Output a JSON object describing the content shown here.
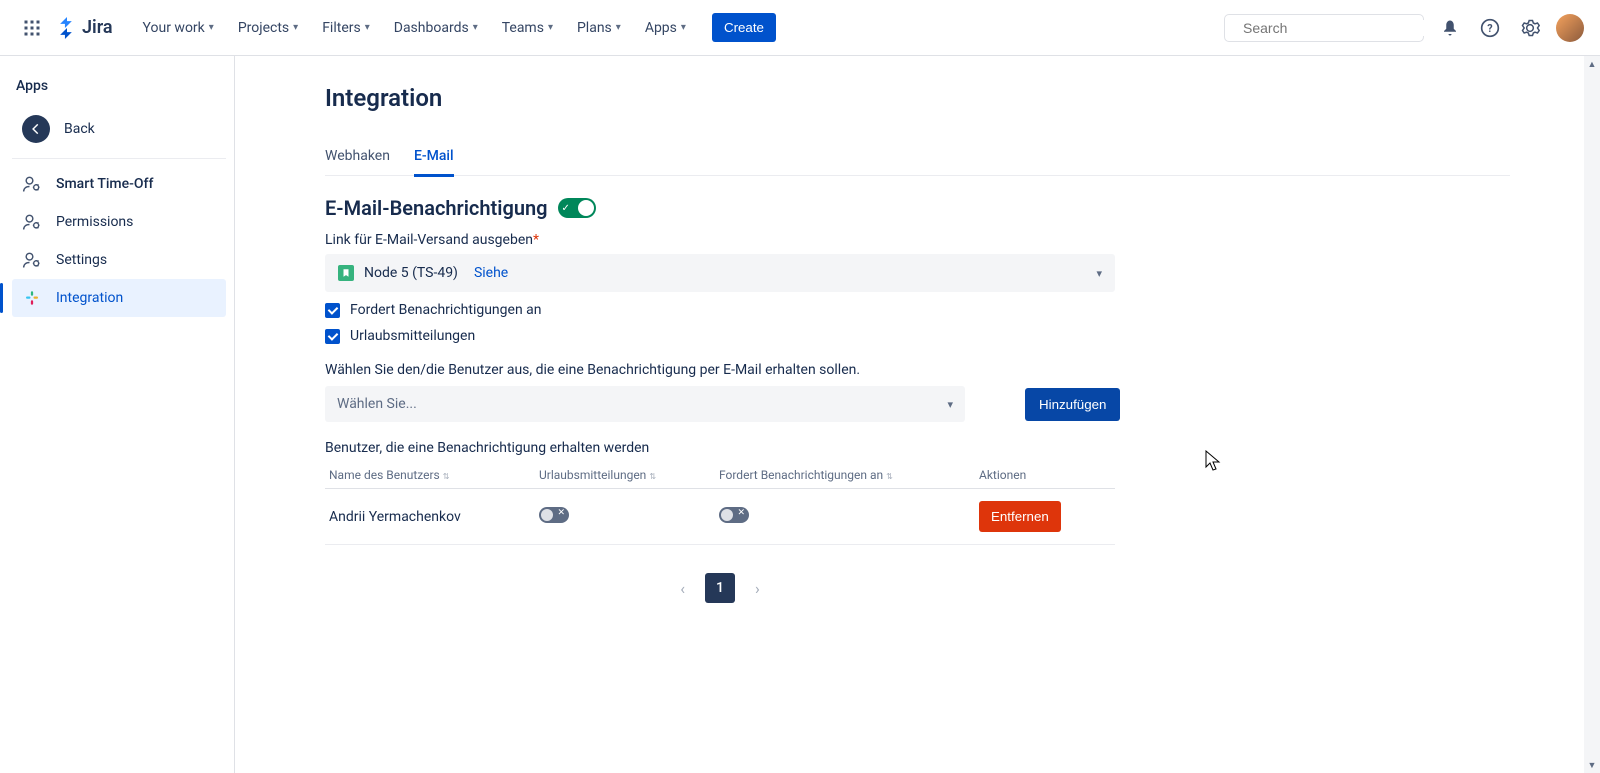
{
  "topnav": {
    "product": "Jira",
    "items": [
      "Your work",
      "Projects",
      "Filters",
      "Dashboards",
      "Teams",
      "Plans",
      "Apps"
    ],
    "create": "Create",
    "search_placeholder": "Search"
  },
  "sidebar": {
    "title": "Apps",
    "back_label": "Back",
    "items": [
      {
        "label": "Smart Time-Off",
        "icon": "user-gear"
      },
      {
        "label": "Permissions",
        "icon": "user-gear"
      },
      {
        "label": "Settings",
        "icon": "user-gear"
      },
      {
        "label": "Integration",
        "icon": "slack",
        "active": true
      }
    ]
  },
  "page": {
    "title": "Integration",
    "tabs": {
      "webhooks": "Webhaken",
      "email": "E-Mail"
    },
    "section_title": "E-Mail-Benachrichtigung",
    "toggle_on": true,
    "link_label": "Link für E-Mail-Versand ausgeben",
    "link_dropdown": {
      "value": "Node 5 (TS-49)",
      "action": "Siehe"
    },
    "cb1": "Fordert Benachrichtigungen an",
    "cb2": "Urlaubsmitteilungen",
    "instruction": "Wählen Sie den/die Benutzer aus, die eine Benachrichtigung per E-Mail erhalten sollen.",
    "user_select_placeholder": "Wählen Sie...",
    "add_button": "Hinzufügen",
    "table_title": "Benutzer, die eine Benachrichtigung erhalten werden",
    "columns": {
      "name": "Name des Benutzers",
      "vac": "Urlaubsmitteilungen",
      "req": "Fordert Benachrichtigungen an",
      "actions": "Aktionen"
    },
    "rows": [
      {
        "name": "Andrii Yermachenkov",
        "vac": false,
        "req": false
      }
    ],
    "remove_btn": "Entfernen",
    "pagination": {
      "current": "1"
    }
  }
}
